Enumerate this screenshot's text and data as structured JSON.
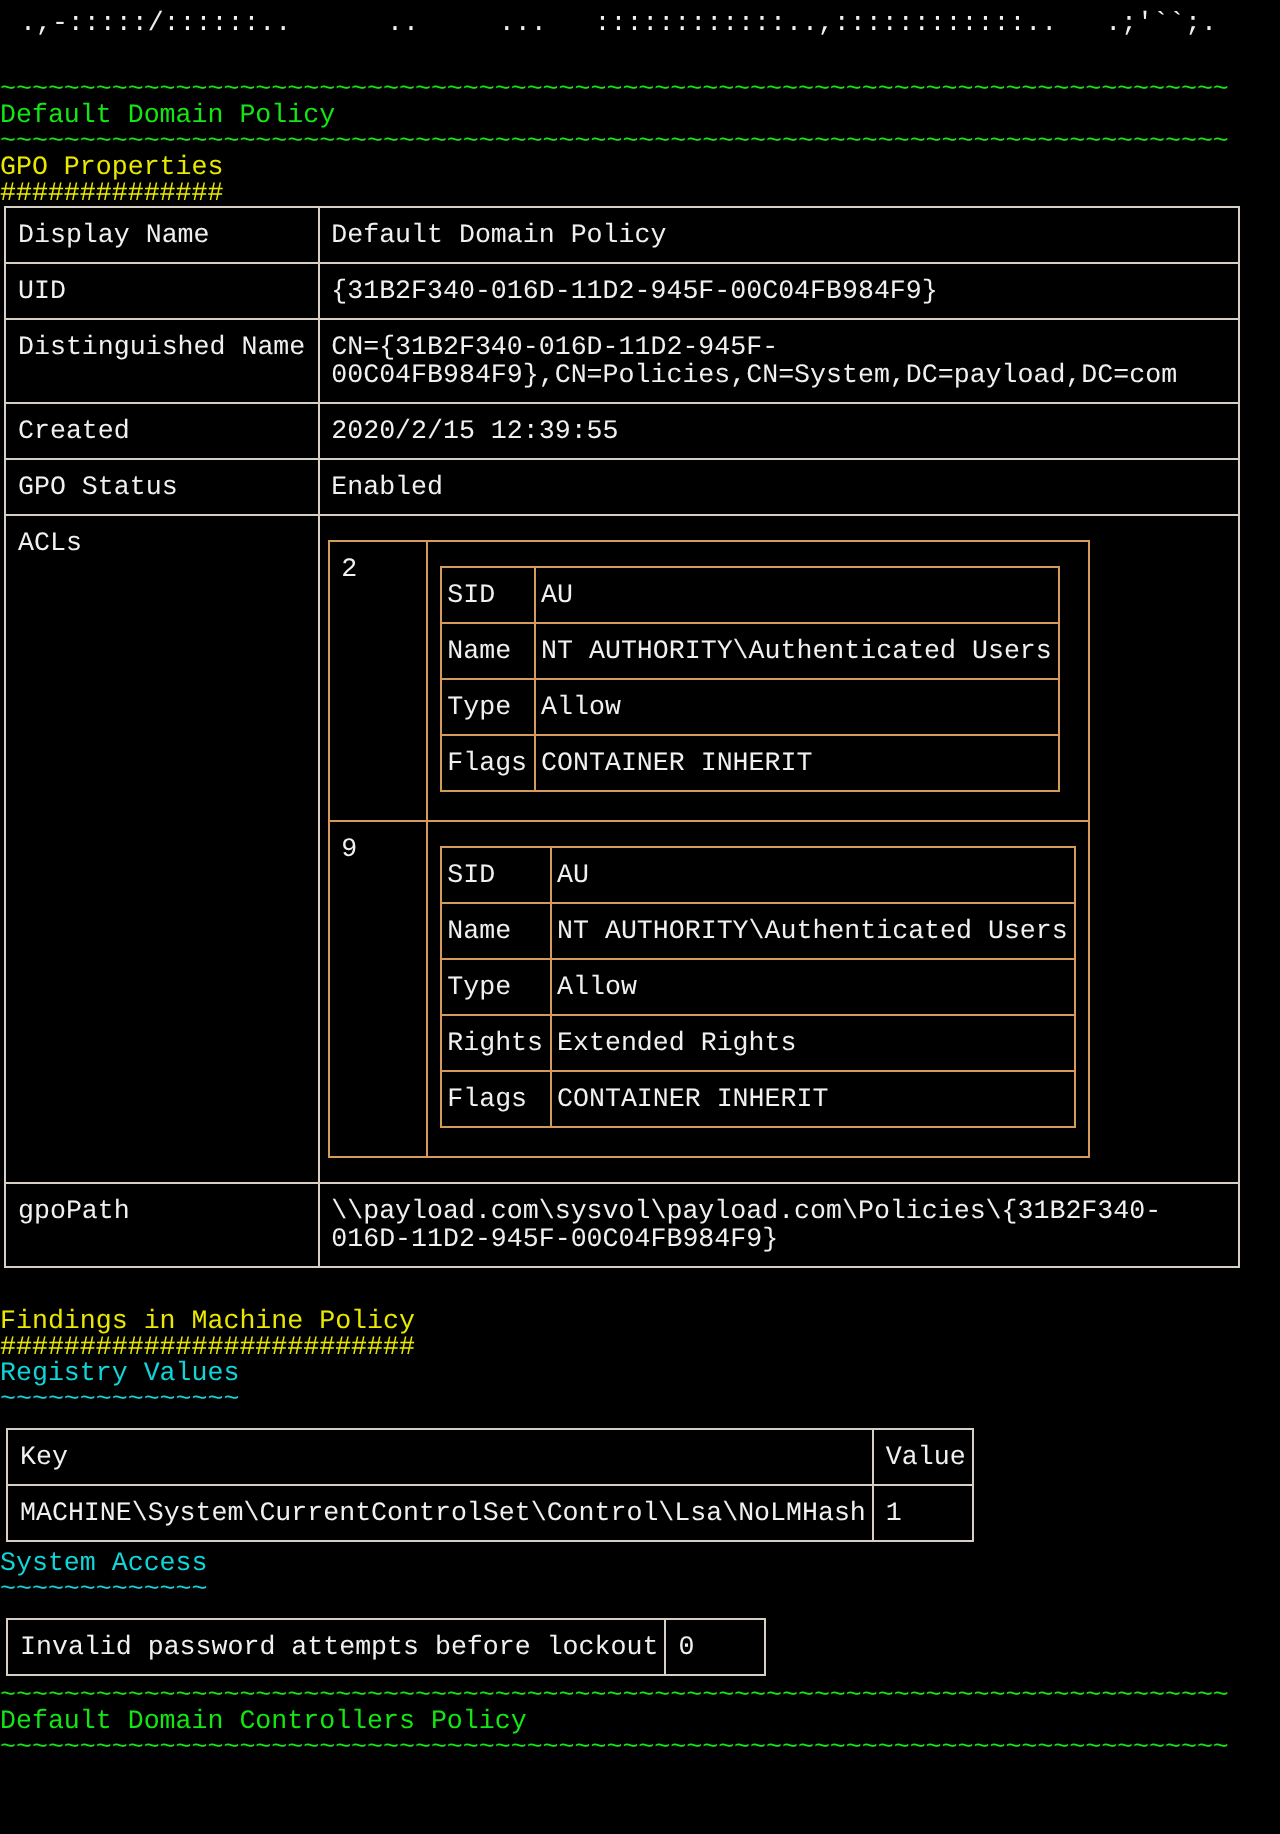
{
  "banner": " .,-:::::/::::::..      ..     ...   ::::::::::::..,::::::::::::..   .;'``;.",
  "sections": [
    {
      "kind": "policy",
      "rule_above": "~~~~~~~~~~~~~~~~~~~~~~~~~~~~~~~~~~~~~~~~~~~~~~~~~~~~~~~~~~~~~~~~~~~~~~~~~~~~~",
      "title": "Default Domain Policy",
      "rule_below": "~~~~~~~~~~~~~~~~~~~~~~~~~~~~~~~~~~~~~~~~~~~~~~~~~~~~~~~~~~~~~~~~~~~~~~~~~~~~~"
    },
    {
      "kind": "heading",
      "title": "GPO Properties",
      "rule_below": "##############"
    },
    {
      "kind": "properties",
      "rows": [
        {
          "label": "Display Name",
          "value": "Default Domain Policy"
        },
        {
          "label": "UID",
          "value": "{31B2F340-016D-11D2-945F-00C04FB984F9}"
        },
        {
          "label": "Distinguished Name",
          "value": "CN={31B2F340-016D-11D2-945F-00C04FB984F9},CN=Policies,CN=System,DC=payload,DC=com"
        },
        {
          "label": "Created",
          "value": "2020/2/15 12:39:55"
        },
        {
          "label": "GPO Status",
          "value": "Enabled"
        },
        {
          "label": "ACLs",
          "acls": [
            {
              "id": "2",
              "entries": [
                {
                  "key": "SID",
                  "value": "AU"
                },
                {
                  "key": "Name",
                  "value": "NT AUTHORITY\\Authenticated Users"
                },
                {
                  "key": "Type",
                  "value": "Allow"
                },
                {
                  "key": "Flags",
                  "value": "CONTAINER INHERIT"
                }
              ]
            },
            {
              "id": "9",
              "entries": [
                {
                  "key": "SID",
                  "value": "AU"
                },
                {
                  "key": "Name",
                  "value": "NT AUTHORITY\\Authenticated Users"
                },
                {
                  "key": "Type",
                  "value": "Allow"
                },
                {
                  "key": "Rights",
                  "value": "Extended Rights"
                },
                {
                  "key": "Flags",
                  "value": "CONTAINER INHERIT"
                }
              ]
            }
          ]
        },
        {
          "label": "gpoPath",
          "value": "\\\\payload.com\\sysvol\\payload.com\\Policies\\{31B2F340-016D-11D2-945F-00C04FB984F9}"
        }
      ]
    },
    {
      "kind": "heading",
      "title": "Findings in Machine Policy",
      "rule_below": "##########################"
    },
    {
      "kind": "subheading",
      "title": "Registry Values",
      "rule_below": "~~~~~~~~~~~~~~~"
    },
    {
      "kind": "table",
      "columns": [
        "Key",
        "Value"
      ],
      "rows": [
        [
          "MACHINE\\System\\CurrentControlSet\\Control\\Lsa\\NoLMHash",
          "1"
        ]
      ]
    },
    {
      "kind": "subheading",
      "title": "System Access",
      "rule_below": "~~~~~~~~~~~~~"
    },
    {
      "kind": "table",
      "rows": [
        [
          "Invalid password attempts before lockout",
          "0"
        ]
      ]
    },
    {
      "kind": "policy",
      "rule_above": "~~~~~~~~~~~~~~~~~~~~~~~~~~~~~~~~~~~~~~~~~~~~~~~~~~~~~~~~~~~~~~~~~~~~~~~~~~~~~",
      "title": "Default Domain Controllers Policy",
      "rule_below": "~~~~~~~~~~~~~~~~~~~~~~~~~~~~~~~~~~~~~~~~~~~~~~~~~~~~~~~~~~~~~~~~~~~~~~~~~~~~~"
    }
  ]
}
